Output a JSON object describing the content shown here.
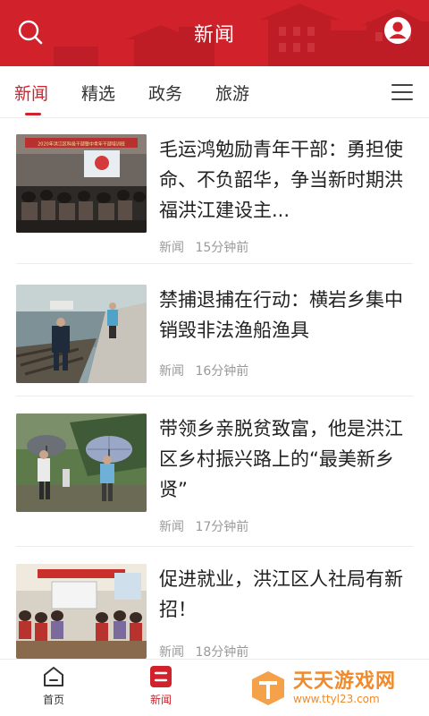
{
  "header": {
    "title": "新闻",
    "search_icon": "search-icon",
    "user_icon": "user-icon",
    "brand_color": "#d1222c"
  },
  "tabs": [
    {
      "label": "新闻",
      "active": true
    },
    {
      "label": "精选",
      "active": false
    },
    {
      "label": "政务",
      "active": false
    },
    {
      "label": "旅游",
      "active": false
    }
  ],
  "menu_icon": "hamburger-menu-icon",
  "feed": [
    {
      "title": "毛运鸿勉励青年干部：勇担使命、不负韶华，争当新时期洪福洪江建设主...",
      "category": "新闻",
      "time": "15分钟前",
      "thumb_banner": "2020年洪江区科级干部暨中青年干部培训班"
    },
    {
      "title": "禁捕退捕在行动：横岩乡集中销毁非法渔船渔具",
      "category": "新闻",
      "time": "16分钟前"
    },
    {
      "title": "带领乡亲脱贫致富，他是洪江区乡村振兴路上的“最美新乡贤”",
      "category": "新闻",
      "time": "17分钟前"
    },
    {
      "title": "促进就业，洪江区人社局有新招！",
      "category": "新闻",
      "time": "18分钟前"
    }
  ],
  "bottom_nav": [
    {
      "label": "首页",
      "icon": "home-icon",
      "active": false
    },
    {
      "label": "新闻",
      "icon": "news-icon",
      "active": true
    }
  ],
  "watermark": {
    "name": "天天游戏网",
    "url": "www.ttyl23.com"
  }
}
